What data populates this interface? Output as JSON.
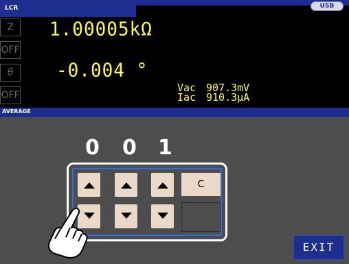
{
  "header": {
    "mode": "LCR",
    "usb_badge": "USB"
  },
  "params": [
    {
      "label": "Z",
      "style": "normal"
    },
    {
      "label": "OFF",
      "style": "normal"
    },
    {
      "label": "θ",
      "style": "italic"
    },
    {
      "label": "OFF",
      "style": "normal"
    }
  ],
  "measurements": {
    "z_value": "1.00005kΩ",
    "theta_value": "-0.004 °",
    "vac_label": "Vac",
    "vac_value": "907.3mV",
    "iac_label": "Iac",
    "iac_value": "910.3μA"
  },
  "average": {
    "title": "AVERAGE",
    "digits": [
      "0",
      "0",
      "1"
    ],
    "clear_label": "C"
  },
  "footer": {
    "exit_label": "EXIT"
  },
  "colors": {
    "accent_blue": "#1d2f8e",
    "value_yellow": "#ffff30",
    "key_face": "#ead8c8",
    "panel_gray": "#4d4d4d",
    "highlight_blue": "#2e6fe8"
  },
  "icons": {
    "pointer": "pointing-hand-icon",
    "up": "triangle-up-icon",
    "down": "triangle-down-icon"
  }
}
